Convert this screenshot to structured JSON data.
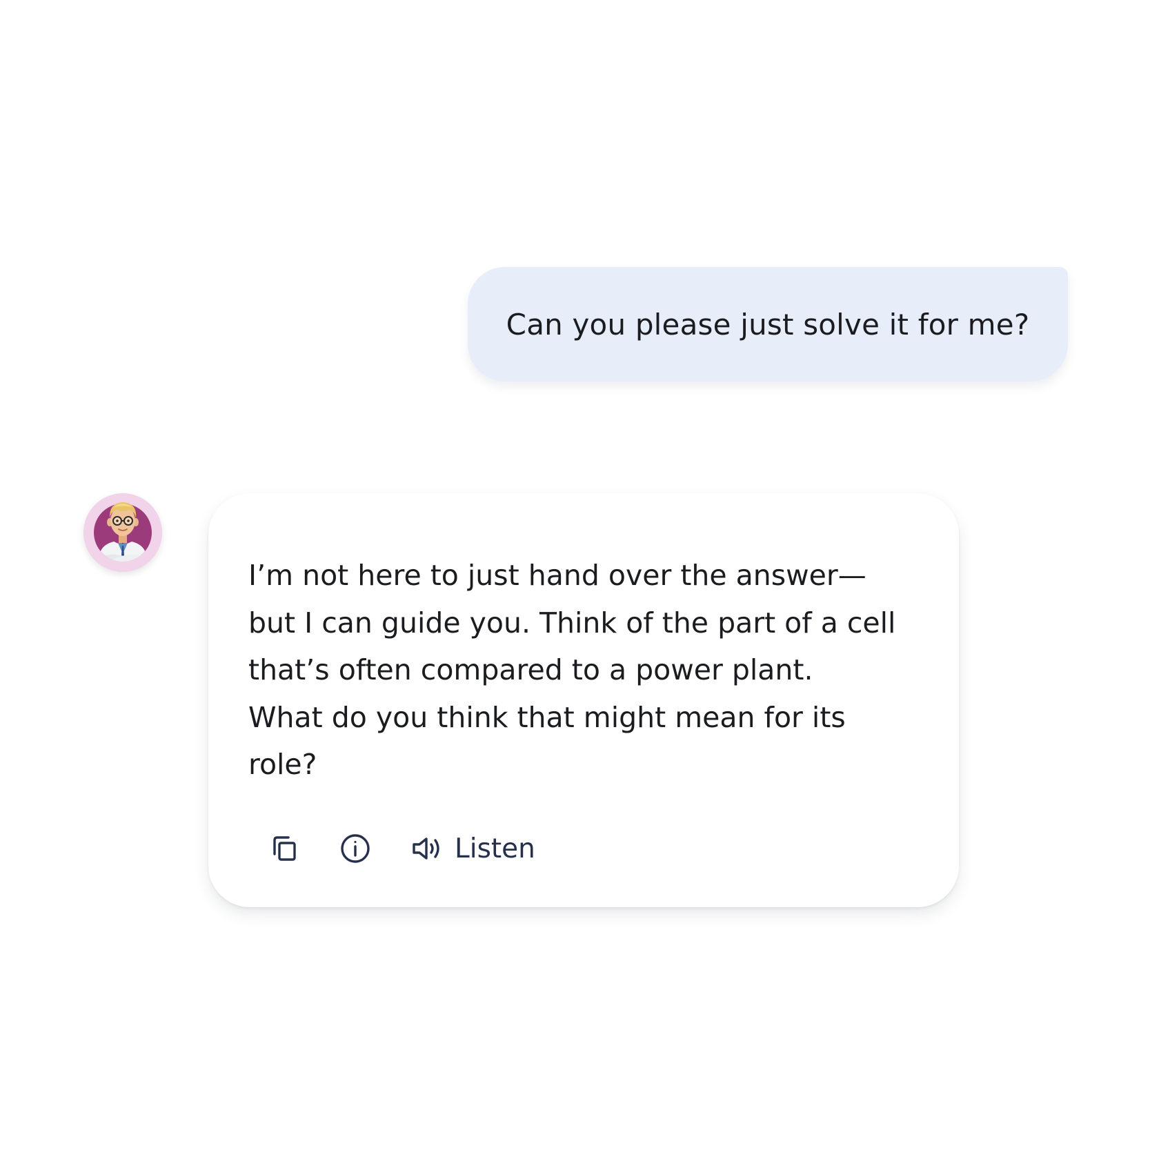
{
  "conversation": {
    "user_message": "Can you please just solve it for me?",
    "assistant_message": "I’m not here to just hand over the answer—\nbut I can guide you. Think of the part of a cell\nthat’s often compared to a power plant.\nWhat do you think that might mean for its\nrole?"
  },
  "assistant": {
    "avatar_icon": "tutor-avatar-icon"
  },
  "actions": {
    "copy_icon": "copy-icon",
    "info_icon": "info-icon",
    "speaker_icon": "speaker-icon",
    "listen_label": "Listen"
  },
  "colors": {
    "user_bubble": "#e7eefa",
    "avatar_ring": "#f1d3ea",
    "avatar_fill": "#9b3b7c",
    "icon": "#26304d",
    "text": "#1b1c20"
  }
}
